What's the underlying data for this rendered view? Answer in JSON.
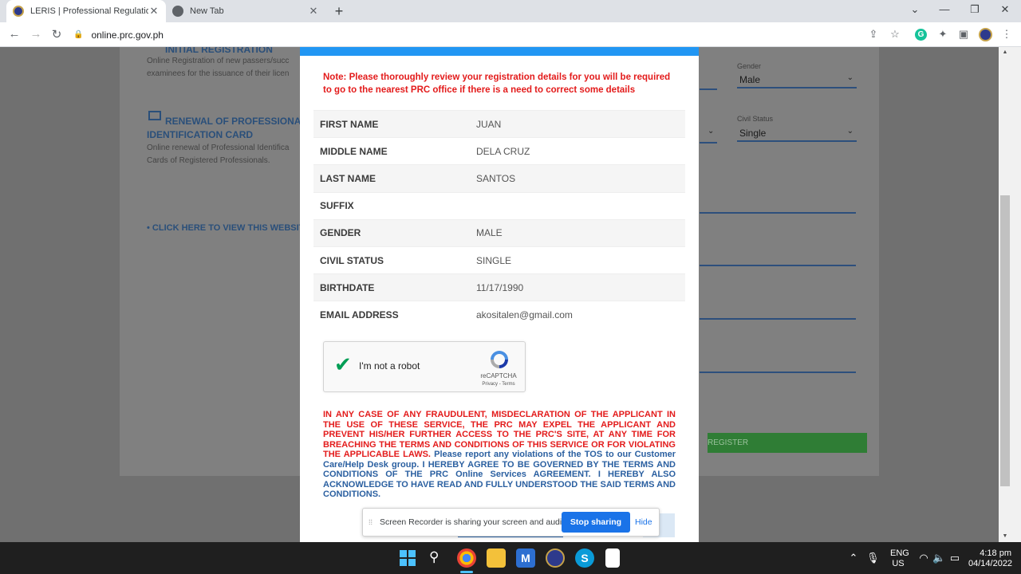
{
  "browser": {
    "tabs": [
      {
        "title": "LERIS | Professional Regulation C",
        "active": true
      },
      {
        "title": "New Tab",
        "active": false
      }
    ],
    "new_tab_icon": "plus-icon",
    "url": "online.prc.gov.ph"
  },
  "background": {
    "initial_registration_heading": "INITIAL REGISTRATION",
    "initial_registration_desc_1": "Online Registration of new passers/succ",
    "initial_registration_desc_2": "examinees for the issuance of their licen",
    "renewal_heading_1": "RENEWAL OF PROFESSIONAL",
    "renewal_heading_2": "IDENTIFICATION CARD",
    "renewal_desc_1": "Online renewal of Professional Identifica",
    "renewal_desc_2": "Cards of Registered Professionals.",
    "website_link": "• CLICK HERE TO VIEW THIS WEBSIT",
    "gender_label": "Gender",
    "gender_value": "Male",
    "civil_status_label": "Civil Status",
    "civil_status_value": "Single",
    "register_button": "REGISTER"
  },
  "modal": {
    "note": "Note: Please thoroughly review your registration details for you will be required to go to the nearest PRC office if there is a need to correct some details",
    "details": [
      {
        "label": "FIRST NAME",
        "value": "JUAN"
      },
      {
        "label": "MIDDLE NAME",
        "value": "DELA CRUZ"
      },
      {
        "label": "LAST NAME",
        "value": "SANTOS"
      },
      {
        "label": "SUFFIX",
        "value": ""
      },
      {
        "label": "GENDER",
        "value": "MALE"
      },
      {
        "label": "CIVIL STATUS",
        "value": "SINGLE"
      },
      {
        "label": "BIRTHDATE",
        "value": "11/17/1990"
      },
      {
        "label": "EMAIL ADDRESS",
        "value": "akositalen@gmail.com"
      }
    ],
    "recaptcha": {
      "label": "I'm not a robot",
      "brand": "reCAPTCHA",
      "links": "Privacy - Terms",
      "checked": true
    },
    "terms_red": "IN ANY CASE OF ANY FRAUDULENT, MISDECLARATION OF THE APPLICANT IN THE USE OF THESE SERVICE, THE PRC MAY EXPEL THE APPLICANT AND PREVENT HIS/HER FURTHER ACCESS TO THE PRC'S SITE, AT ANY TIME FOR BREACHING THE TERMS AND CONDITIONS OF THIS SERVICE OR FOR VIOLATING THE APPLICABLE LAWS.",
    "terms_blue": " Please report any violations of the TOS to our Customer Care/Help Desk group. I HEREBY AGREE TO BE GOVERNED BY THE TERMS AND CONDITIONS OF THE PRC Online Services AGREEMENT. I HEREBY ALSO ACKNOWLEDGE TO HAVE READ AND FULLY UNDERSTOOD THE SAID TERMS AND CONDITIONS."
  },
  "screen_recorder": {
    "message": "Screen Recorder is sharing your screen and audio.",
    "stop_button": "Stop sharing",
    "hide_button": "Hide"
  },
  "taskbar": {
    "lang_1": "ENG",
    "lang_2": "US",
    "time": "4:18 pm",
    "date": "04/14/2022"
  },
  "colors": {
    "modal_accent": "#2196f3",
    "warning_red": "#e31b1b",
    "terms_blue": "#2a5fa0",
    "stop_button": "#1a73e8"
  }
}
